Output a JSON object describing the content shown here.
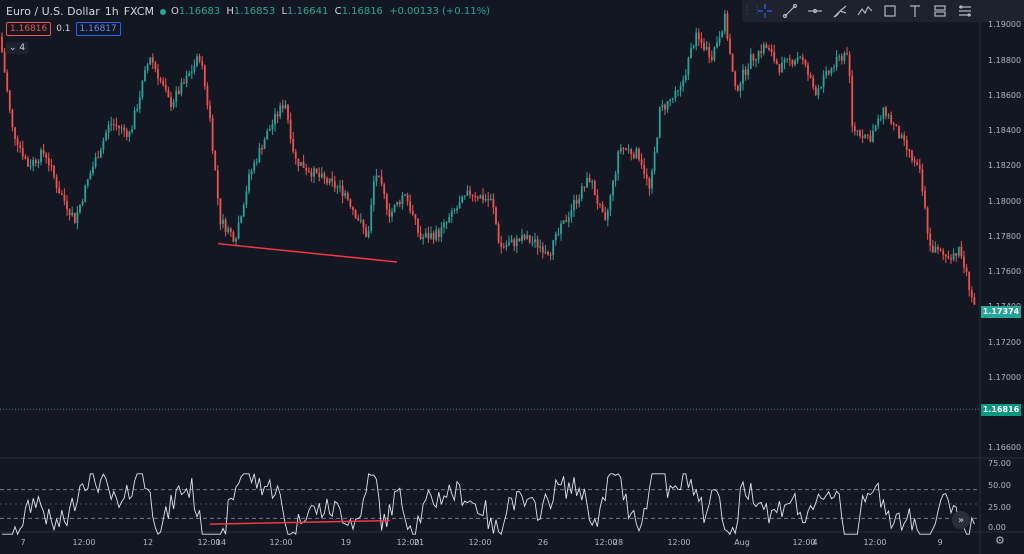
{
  "header": {
    "symbol_name": "Euro / U.S. Dollar",
    "interval": "1h",
    "exchange": "FXCM",
    "open_label": "O",
    "open": "1.16683",
    "high_label": "H",
    "high": "1.16853",
    "low_label": "L",
    "low": "1.16641",
    "close_label": "C",
    "close": "1.16816",
    "change": "+0.00133 (+0.11%)"
  },
  "trade": {
    "sell_price": "1.16816",
    "spread": "0.1",
    "buy_price": "1.16817"
  },
  "collapse_label": "4",
  "price_axis": {
    "ticks": [
      "1.19000",
      "1.18800",
      "1.18600",
      "1.18400",
      "1.18200",
      "1.18000",
      "1.17800",
      "1.17600",
      "1.17400",
      "1.17200",
      "1.17000",
      "1.16600"
    ],
    "last_price": "1.17374",
    "current_price": "1.16816"
  },
  "rsi_axis": {
    "ticks": [
      "75.00",
      "50.00",
      "25.00",
      "0.00"
    ],
    "upper": 70,
    "mid": 50,
    "lower": 30
  },
  "time_axis": [
    "7",
    "12:00",
    "12",
    "12:00",
    "14",
    "12:00",
    "19",
    "12:00",
    "21",
    "12:00",
    "26",
    "12:00",
    "28",
    "12:00",
    "Aug",
    "12:00",
    "4",
    "12:00",
    "9"
  ],
  "toolbar": {
    "tools": [
      "crosshair-icon",
      "trend-line-icon",
      "horizontal-ray-icon",
      "pitchfork-icon",
      "pattern-icon",
      "rectangle-icon",
      "text-icon",
      "long-position-icon",
      "measure-icon"
    ]
  },
  "colors": {
    "background": "#131722",
    "up": "#26a69a",
    "down": "#ef5350",
    "divergence": "#f23645"
  },
  "chart_data": {
    "type": "candlestick",
    "symbol": "EURUSD",
    "interval": "1h",
    "price_range": [
      1.1655,
      1.1905
    ],
    "key_levels": {
      "last_price": 1.17374,
      "current_price": 1.16816
    },
    "close_path": [
      [
        0,
        1.1885
      ],
      [
        12,
        1.1835
      ],
      [
        28,
        1.1815
      ],
      [
        45,
        1.1822
      ],
      [
        58,
        1.1802
      ],
      [
        75,
        1.1785
      ],
      [
        90,
        1.181
      ],
      [
        110,
        1.1838
      ],
      [
        130,
        1.1832
      ],
      [
        150,
        1.1875
      ],
      [
        170,
        1.1848
      ],
      [
        185,
        1.186
      ],
      [
        200,
        1.1875
      ],
      [
        210,
        1.184
      ],
      [
        220,
        1.1785
      ],
      [
        235,
        1.1775
      ],
      [
        250,
        1.181
      ],
      [
        265,
        1.183
      ],
      [
        285,
        1.185
      ],
      [
        295,
        1.1818
      ],
      [
        320,
        1.1808
      ],
      [
        345,
        1.18
      ],
      [
        368,
        1.1775
      ],
      [
        375,
        1.1812
      ],
      [
        390,
        1.1788
      ],
      [
        405,
        1.18
      ],
      [
        420,
        1.1775
      ],
      [
        440,
        1.1778
      ],
      [
        455,
        1.179
      ],
      [
        470,
        1.18
      ],
      [
        492,
        1.1795
      ],
      [
        500,
        1.177
      ],
      [
        525,
        1.1775
      ],
      [
        550,
        1.1768
      ],
      [
        575,
        1.1795
      ],
      [
        590,
        1.1808
      ],
      [
        605,
        1.1782
      ],
      [
        620,
        1.1825
      ],
      [
        640,
        1.182
      ],
      [
        650,
        1.18
      ],
      [
        660,
        1.1845
      ],
      [
        680,
        1.1855
      ],
      [
        695,
        1.1885
      ],
      [
        712,
        1.1875
      ],
      [
        725,
        1.1895
      ],
      [
        735,
        1.1855
      ],
      [
        750,
        1.1872
      ],
      [
        765,
        1.188
      ],
      [
        780,
        1.1868
      ],
      [
        800,
        1.1875
      ],
      [
        815,
        1.1855
      ],
      [
        835,
        1.187
      ],
      [
        848,
        1.1878
      ],
      [
        852,
        1.1835
      ],
      [
        870,
        1.183
      ],
      [
        885,
        1.1845
      ],
      [
        900,
        1.183
      ],
      [
        920,
        1.181
      ],
      [
        930,
        1.177
      ],
      [
        945,
        1.1765
      ],
      [
        960,
        1.1768
      ],
      [
        975,
        1.1737
      ]
    ],
    "divergence_price_line": [
      [
        218,
        1.1772
      ],
      [
        397,
        1.1762
      ]
    ],
    "rsi": {
      "levels": [
        70,
        50,
        30
      ],
      "range": [
        0,
        100
      ],
      "divergence_line": [
        [
          210,
          22
        ],
        [
          390,
          27
        ]
      ]
    }
  }
}
